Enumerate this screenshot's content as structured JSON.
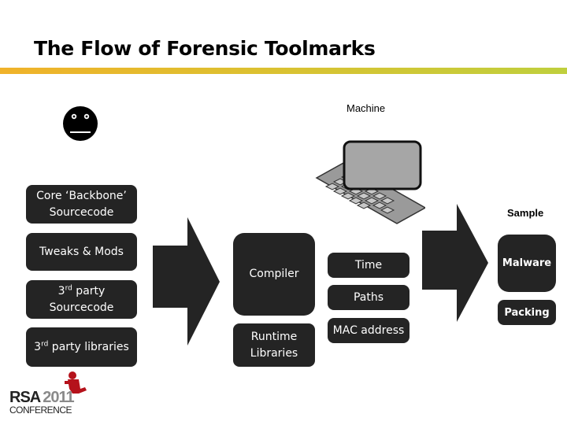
{
  "slide": {
    "title": "The Flow of Forensic Toolmarks",
    "accent_gradient": [
      "#f0b22a",
      "#dcc030",
      "#bfcf3d"
    ]
  },
  "author_icon": "smiley-face-icon",
  "sources": [
    {
      "line1": "Core ‘Backbone’",
      "line2": "Sourcecode"
    },
    {
      "line1": "Tweaks & Mods"
    },
    {
      "line1_num": "3",
      "line1_sup": "rd",
      "line1_rest": " party",
      "line2": "Sourcecode"
    },
    {
      "line1_num": "3",
      "line1_sup": "rd",
      "line1_rest": " party libraries"
    }
  ],
  "build": {
    "compiler": "Compiler",
    "runtime_line1": "Runtime",
    "runtime_line2": "Libraries"
  },
  "machine": {
    "label": "Machine",
    "icon": "laptop-icon",
    "attributes": [
      "Time",
      "Paths",
      "MAC address"
    ]
  },
  "sample": {
    "label": "Sample",
    "malware": "Malware",
    "packing": "Packing"
  },
  "logo": {
    "brand": "RSA",
    "year": "2011",
    "subtitle": "CONFERENCE"
  }
}
